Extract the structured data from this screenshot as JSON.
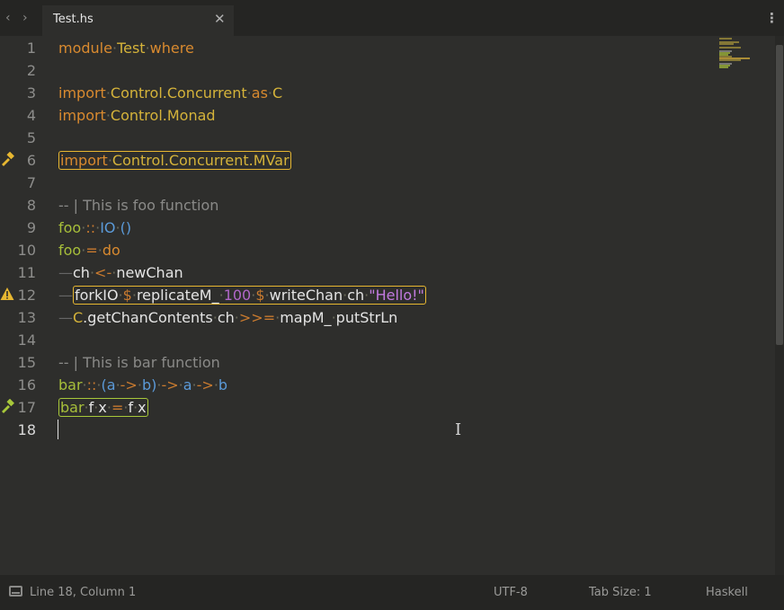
{
  "tab": {
    "title": "Test.hs",
    "close": "✕",
    "back": "‹",
    "forward": "›",
    "more": "⋮"
  },
  "lines": [
    {
      "n": "1"
    },
    {
      "n": "2"
    },
    {
      "n": "3"
    },
    {
      "n": "4"
    },
    {
      "n": "5"
    },
    {
      "n": "6"
    },
    {
      "n": "7"
    },
    {
      "n": "8"
    },
    {
      "n": "9"
    },
    {
      "n": "10"
    },
    {
      "n": "11"
    },
    {
      "n": "12"
    },
    {
      "n": "13"
    },
    {
      "n": "14"
    },
    {
      "n": "15"
    },
    {
      "n": "16"
    },
    {
      "n": "17"
    },
    {
      "n": "18"
    }
  ],
  "code": {
    "l1": {
      "kw1": "module",
      "mod": "Test",
      "kw2": "where"
    },
    "l3": {
      "kw": "import",
      "mod": "Control.Concurrent",
      "as": "as",
      "alias": "C"
    },
    "l4": {
      "kw": "import",
      "mod": "Control.Monad"
    },
    "l6": {
      "kw": "import",
      "mod": "Control.Concurrent.MVar"
    },
    "l8": {
      "comment": "-- | This is foo function"
    },
    "l9": {
      "name": "foo",
      "sig": "::",
      "t1": "IO",
      "t2": "()"
    },
    "l10": {
      "name": "foo",
      "eq": "=",
      "kw": "do"
    },
    "l11": {
      "v": "ch",
      "arrow": "<-",
      "f": "newChan"
    },
    "l12": {
      "f1": "forkIO",
      "d1": "$",
      "f2": "replicateM_",
      "num": "100",
      "d2": "$",
      "f3": "writeChan",
      "v": "ch",
      "str": "\"Hello!\""
    },
    "l13": {
      "mod": "C",
      "f1": ".getChanContents",
      "v": "ch",
      "op": ">>=",
      "f2": "mapM_",
      "f3": "putStrLn"
    },
    "l15": {
      "comment": "-- | This is bar function"
    },
    "l16": {
      "name": "bar",
      "sig": "::",
      "t": "(a",
      "ar1": "->",
      "t2": "b)",
      "ar2": "->",
      "t3": "a",
      "ar3": "->",
      "t4": "b"
    },
    "l17": {
      "name": "bar",
      "a1": "f",
      "a2": "x",
      "eq": "=",
      "a3": "f",
      "a4": "x"
    }
  },
  "gutter": {
    "warn_icon": "⚠",
    "fix_warn_icon": "🔨",
    "fix_ok_icon": "🔨"
  },
  "status": {
    "position": "Line 18, Column 1",
    "encoding": "UTF-8",
    "tab_size": "Tab Size: 1",
    "syntax": "Haskell"
  },
  "colors": {
    "warning": "#e7b731",
    "ok": "#a8c83a",
    "background": "#2e2e2c"
  }
}
